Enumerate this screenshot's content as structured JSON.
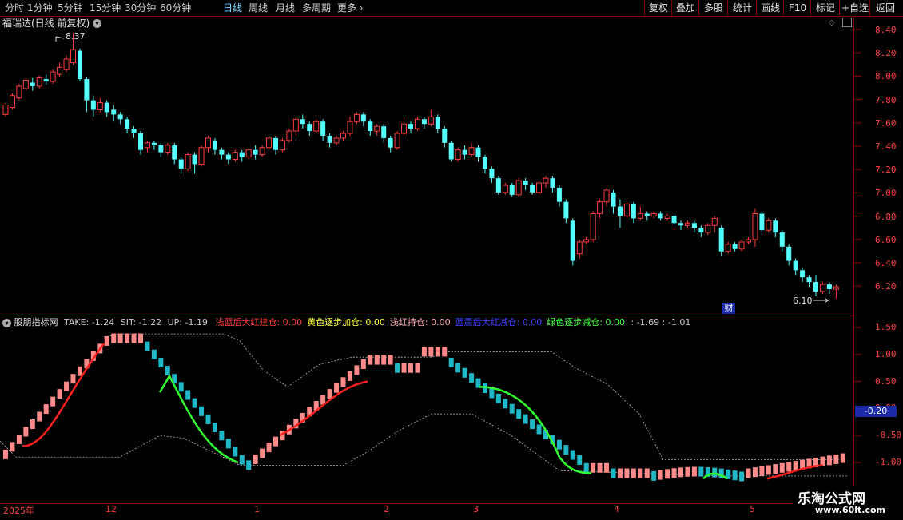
{
  "toolbar": {
    "periods": [
      "分时",
      "1分钟",
      "5分钟",
      "15分钟",
      "30分钟",
      "60分钟",
      "日线",
      "周线",
      "月线",
      "多周期",
      "更多"
    ],
    "active_index": 6,
    "right_buttons": [
      "复权",
      "叠加",
      "多股",
      "统计",
      "画线",
      "F10",
      "标记",
      "+自选",
      "返回"
    ]
  },
  "stock": {
    "title": "福瑞达(日线 前复权)",
    "high_label": "8.37",
    "low_label": "6.10",
    "cai_badge": "财"
  },
  "price_axis": [
    "8.40",
    "8.20",
    "8.00",
    "7.80",
    "7.60",
    "7.40",
    "7.20",
    "7.00",
    "6.80",
    "6.60",
    "6.40",
    "6.20"
  ],
  "indicator": {
    "name": "股朋指标网",
    "take": "TAKE: -1.24",
    "sit": "SIT: -1.22",
    "up": "UP: -1.19",
    "items": [
      {
        "label": "浅蓝后大红建仓:",
        "value": "0.00",
        "color": "#ff3c3c"
      },
      {
        "label": "黄色逐步加仓:",
        "value": "0.00",
        "color": "#ffff40"
      },
      {
        "label": "浅红持仓:",
        "value": "0.00",
        "color": "#ffb0b0"
      },
      {
        "label": "蓝震后大红减仓:",
        "value": "0.00",
        "color": "#4040ff"
      },
      {
        "label": "绿色逐步减仓:",
        "value": "0.00",
        "color": "#40ff40"
      }
    ],
    "tail": ": -1.69  : -1.01",
    "axis": [
      "1.50",
      "1.00",
      "0.50",
      "0.00",
      "-0.50",
      "-1.00"
    ],
    "current": "-0.20"
  },
  "dates": [
    {
      "label": "2025年",
      "x": 4
    },
    {
      "label": "12",
      "x": 132
    },
    {
      "label": "1",
      "x": 318
    },
    {
      "label": "2",
      "x": 480
    },
    {
      "label": "3",
      "x": 592
    },
    {
      "label": "4",
      "x": 768
    },
    {
      "label": "5",
      "x": 938
    }
  ],
  "watermark": {
    "title": "乐淘公式网",
    "url": "www.60lt.com"
  },
  "colors": {
    "up": "#ff3c3c",
    "down": "#54ffff",
    "accent": "#6fd3ff"
  },
  "chart_data": {
    "type": "candlestick",
    "ylim": [
      6.1,
      8.45
    ],
    "candles": [
      [
        7.68,
        7.76,
        7.66,
        7.78
      ],
      [
        7.74,
        7.84,
        7.72,
        7.86
      ],
      [
        7.82,
        7.92,
        7.8,
        7.94
      ],
      [
        7.9,
        7.97,
        7.88,
        7.99
      ],
      [
        7.95,
        7.92,
        7.88,
        7.99
      ],
      [
        7.92,
        7.99,
        7.9,
        8.01
      ],
      [
        7.98,
        7.96,
        7.93,
        8.02
      ],
      [
        7.96,
        8.04,
        7.94,
        8.06
      ],
      [
        8.02,
        8.08,
        8.0,
        8.12
      ],
      [
        8.06,
        8.15,
        8.04,
        8.18
      ],
      [
        8.12,
        8.23,
        8.1,
        8.37
      ],
      [
        8.22,
        7.98,
        7.96,
        8.24
      ],
      [
        7.98,
        7.8,
        7.7,
        8.0
      ],
      [
        7.8,
        7.72,
        7.66,
        7.84
      ],
      [
        7.72,
        7.78,
        7.7,
        7.82
      ],
      [
        7.78,
        7.7,
        7.66,
        7.8
      ],
      [
        7.72,
        7.68,
        7.62,
        7.76
      ],
      [
        7.68,
        7.64,
        7.6,
        7.7
      ],
      [
        7.64,
        7.56,
        7.52,
        7.66
      ],
      [
        7.56,
        7.52,
        7.48,
        7.58
      ],
      [
        7.52,
        7.38,
        7.34,
        7.54
      ],
      [
        7.4,
        7.44,
        7.36,
        7.46
      ],
      [
        7.44,
        7.42,
        7.38,
        7.46
      ],
      [
        7.42,
        7.36,
        7.32,
        7.44
      ],
      [
        7.36,
        7.42,
        7.34,
        7.44
      ],
      [
        7.42,
        7.3,
        7.26,
        7.44
      ],
      [
        7.3,
        7.22,
        7.18,
        7.32
      ],
      [
        7.22,
        7.34,
        7.2,
        7.36
      ],
      [
        7.34,
        7.26,
        7.18,
        7.36
      ],
      [
        7.26,
        7.4,
        7.24,
        7.42
      ],
      [
        7.4,
        7.48,
        7.36,
        7.5
      ],
      [
        7.46,
        7.38,
        7.34,
        7.48
      ],
      [
        7.38,
        7.34,
        7.3,
        7.4
      ],
      [
        7.34,
        7.3,
        7.26,
        7.36
      ],
      [
        7.3,
        7.36,
        7.28,
        7.38
      ],
      [
        7.36,
        7.32,
        7.28,
        7.38
      ],
      [
        7.32,
        7.38,
        7.3,
        7.4
      ],
      [
        7.38,
        7.34,
        7.3,
        7.42
      ],
      [
        7.34,
        7.4,
        7.32,
        7.42
      ],
      [
        7.4,
        7.48,
        7.38,
        7.5
      ],
      [
        7.48,
        7.38,
        7.34,
        7.5
      ],
      [
        7.38,
        7.46,
        7.36,
        7.48
      ],
      [
        7.46,
        7.54,
        7.44,
        7.56
      ],
      [
        7.54,
        7.64,
        7.5,
        7.66
      ],
      [
        7.64,
        7.6,
        7.56,
        7.68
      ],
      [
        7.6,
        7.54,
        7.5,
        7.62
      ],
      [
        7.54,
        7.62,
        7.52,
        7.64
      ],
      [
        7.62,
        7.5,
        7.46,
        7.64
      ],
      [
        7.5,
        7.44,
        7.4,
        7.52
      ],
      [
        7.44,
        7.48,
        7.42,
        7.5
      ],
      [
        7.48,
        7.52,
        7.46,
        7.54
      ],
      [
        7.52,
        7.62,
        7.5,
        7.66
      ],
      [
        7.62,
        7.68,
        7.6,
        7.7
      ],
      [
        7.68,
        7.62,
        7.58,
        7.7
      ],
      [
        7.62,
        7.54,
        7.5,
        7.64
      ],
      [
        7.54,
        7.58,
        7.5,
        7.6
      ],
      [
        7.58,
        7.48,
        7.44,
        7.6
      ],
      [
        7.48,
        7.4,
        7.36,
        7.5
      ],
      [
        7.4,
        7.52,
        7.38,
        7.54
      ],
      [
        7.52,
        7.6,
        7.5,
        7.66
      ],
      [
        7.6,
        7.56,
        7.52,
        7.62
      ],
      [
        7.56,
        7.64,
        7.54,
        7.66
      ],
      [
        7.64,
        7.6,
        7.56,
        7.66
      ],
      [
        7.6,
        7.66,
        7.58,
        7.72
      ],
      [
        7.66,
        7.56,
        7.52,
        7.68
      ],
      [
        7.56,
        7.44,
        7.4,
        7.58
      ],
      [
        7.44,
        7.3,
        7.28,
        7.46
      ],
      [
        7.3,
        7.38,
        7.28,
        7.4
      ],
      [
        7.38,
        7.34,
        7.3,
        7.42
      ],
      [
        7.34,
        7.4,
        7.32,
        7.44
      ],
      [
        7.4,
        7.32,
        7.28,
        7.42
      ],
      [
        7.32,
        7.22,
        7.18,
        7.34
      ],
      [
        7.22,
        7.14,
        7.1,
        7.24
      ],
      [
        7.14,
        7.02,
        7.0,
        7.16
      ],
      [
        7.02,
        7.08,
        7.0,
        7.1
      ],
      [
        7.08,
        7.0,
        6.98,
        7.1
      ],
      [
        7.0,
        7.12,
        6.98,
        7.14
      ],
      [
        7.12,
        7.08,
        7.04,
        7.14
      ],
      [
        7.08,
        7.02,
        7.0,
        7.1
      ],
      [
        7.02,
        7.1,
        7.0,
        7.12
      ],
      [
        7.1,
        7.14,
        7.06,
        7.16
      ],
      [
        7.14,
        7.06,
        7.02,
        7.16
      ],
      [
        7.06,
        6.94,
        6.9,
        7.08
      ],
      [
        6.94,
        6.8,
        6.76,
        6.96
      ],
      [
        6.78,
        6.44,
        6.4,
        6.8
      ],
      [
        6.5,
        6.6,
        6.46,
        6.62
      ],
      [
        6.6,
        6.62,
        6.58,
        6.64
      ],
      [
        6.62,
        6.84,
        6.6,
        6.86
      ],
      [
        6.84,
        6.94,
        6.8,
        6.96
      ],
      [
        6.94,
        7.04,
        6.9,
        7.06
      ],
      [
        7.02,
        6.9,
        6.84,
        7.04
      ],
      [
        6.9,
        6.82,
        6.72,
        6.96
      ],
      [
        6.82,
        6.92,
        6.8,
        6.94
      ],
      [
        6.92,
        6.8,
        6.76,
        6.94
      ],
      [
        6.8,
        6.84,
        6.78,
        6.9
      ],
      [
        6.84,
        6.82,
        6.78,
        6.86
      ],
      [
        6.82,
        6.84,
        6.8,
        6.86
      ],
      [
        6.84,
        6.8,
        6.78,
        6.86
      ],
      [
        6.8,
        6.82,
        6.78,
        6.84
      ],
      [
        6.82,
        6.76,
        6.72,
        6.84
      ],
      [
        6.76,
        6.74,
        6.7,
        6.78
      ],
      [
        6.74,
        6.76,
        6.72,
        6.78
      ],
      [
        6.76,
        6.72,
        6.68,
        6.78
      ],
      [
        6.72,
        6.68,
        6.64,
        6.74
      ],
      [
        6.68,
        6.74,
        6.66,
        6.76
      ],
      [
        6.74,
        6.8,
        6.68,
        6.82
      ],
      [
        6.72,
        6.52,
        6.48,
        6.74
      ],
      [
        6.52,
        6.58,
        6.5,
        6.6
      ],
      [
        6.58,
        6.54,
        6.52,
        6.6
      ],
      [
        6.54,
        6.6,
        6.52,
        6.62
      ],
      [
        6.6,
        6.62,
        6.58,
        6.64
      ],
      [
        6.62,
        6.84,
        6.56,
        6.88
      ],
      [
        6.84,
        6.7,
        6.66,
        6.86
      ],
      [
        6.7,
        6.78,
        6.68,
        6.8
      ],
      [
        6.78,
        6.68,
        6.64,
        6.8
      ],
      [
        6.68,
        6.56,
        6.52,
        6.7
      ],
      [
        6.56,
        6.44,
        6.4,
        6.58
      ],
      [
        6.44,
        6.36,
        6.32,
        6.46
      ],
      [
        6.36,
        6.3,
        6.26,
        6.38
      ],
      [
        6.3,
        6.26,
        6.22,
        6.32
      ],
      [
        6.26,
        6.18,
        6.14,
        6.32
      ],
      [
        6.18,
        6.24,
        6.16,
        6.26
      ],
      [
        6.24,
        6.2,
        6.16,
        6.26
      ],
      [
        6.2,
        6.22,
        6.12,
        6.24
      ]
    ]
  }
}
